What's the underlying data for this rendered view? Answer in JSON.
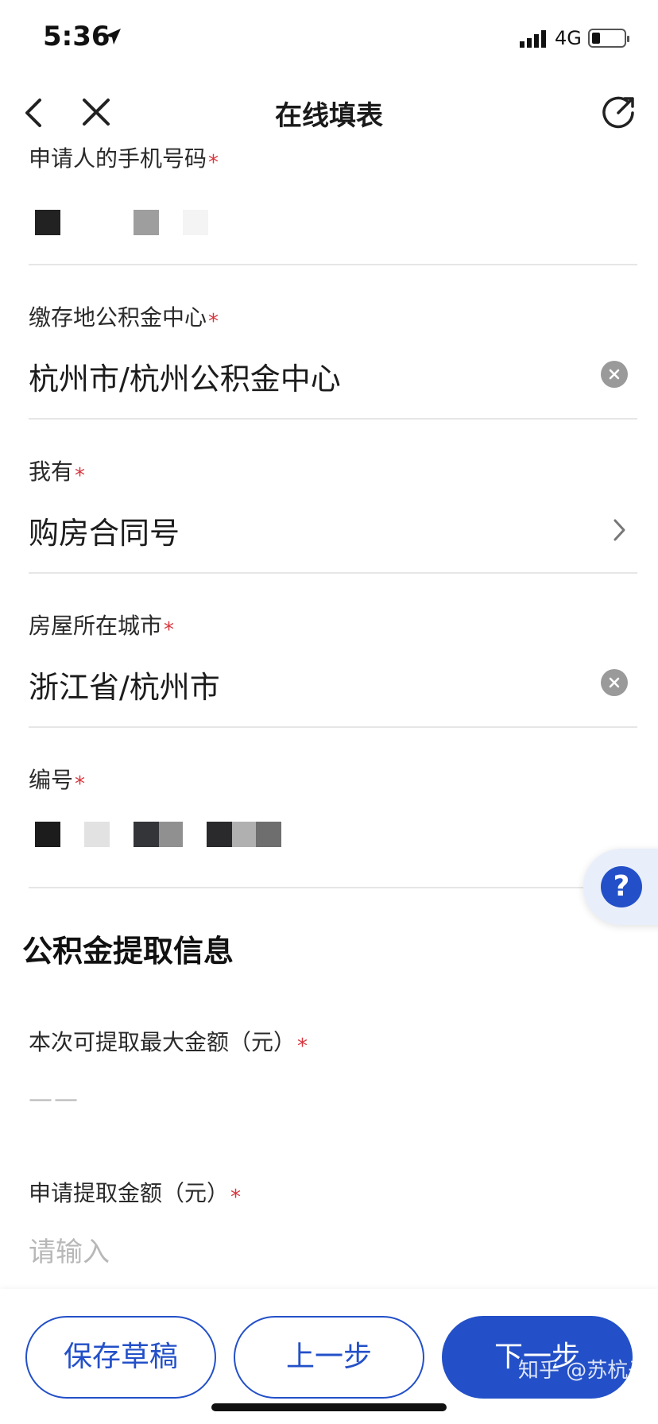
{
  "status": {
    "time": "5:36",
    "network": "4G",
    "icons": [
      "location-arrow-icon",
      "signal-icon",
      "battery-icon"
    ]
  },
  "nav": {
    "title": "在线填表",
    "icons": [
      "back-icon",
      "close-icon",
      "share-icon"
    ]
  },
  "form": {
    "phone": {
      "label": "申请人的手机号码",
      "required": "*"
    },
    "center": {
      "label": "缴存地公积金中心",
      "required": "*",
      "value": "杭州市/杭州公积金中心"
    },
    "have": {
      "label": "我有",
      "required": "*",
      "value": "购房合同号"
    },
    "city": {
      "label": "房屋所在城市",
      "required": "*",
      "value": "浙江省/杭州市"
    },
    "number": {
      "label": "编号",
      "required": "*"
    }
  },
  "section": {
    "title": "公积金提取信息",
    "max_amount": {
      "label": "本次可提取最大金额（元）",
      "required": "*",
      "value": "——"
    },
    "apply_amount": {
      "label": "申请提取金额（元）",
      "required": "*",
      "placeholder": "请输入"
    }
  },
  "help": {
    "label": "?"
  },
  "buttons": {
    "save": "保存草稿",
    "prev": "上一步",
    "next": "下一步"
  },
  "watermark": "知乎 @苏杭子",
  "colors": {
    "accent": "#2350c8",
    "required": "#d9363e",
    "divider": "#e6e6e6"
  }
}
